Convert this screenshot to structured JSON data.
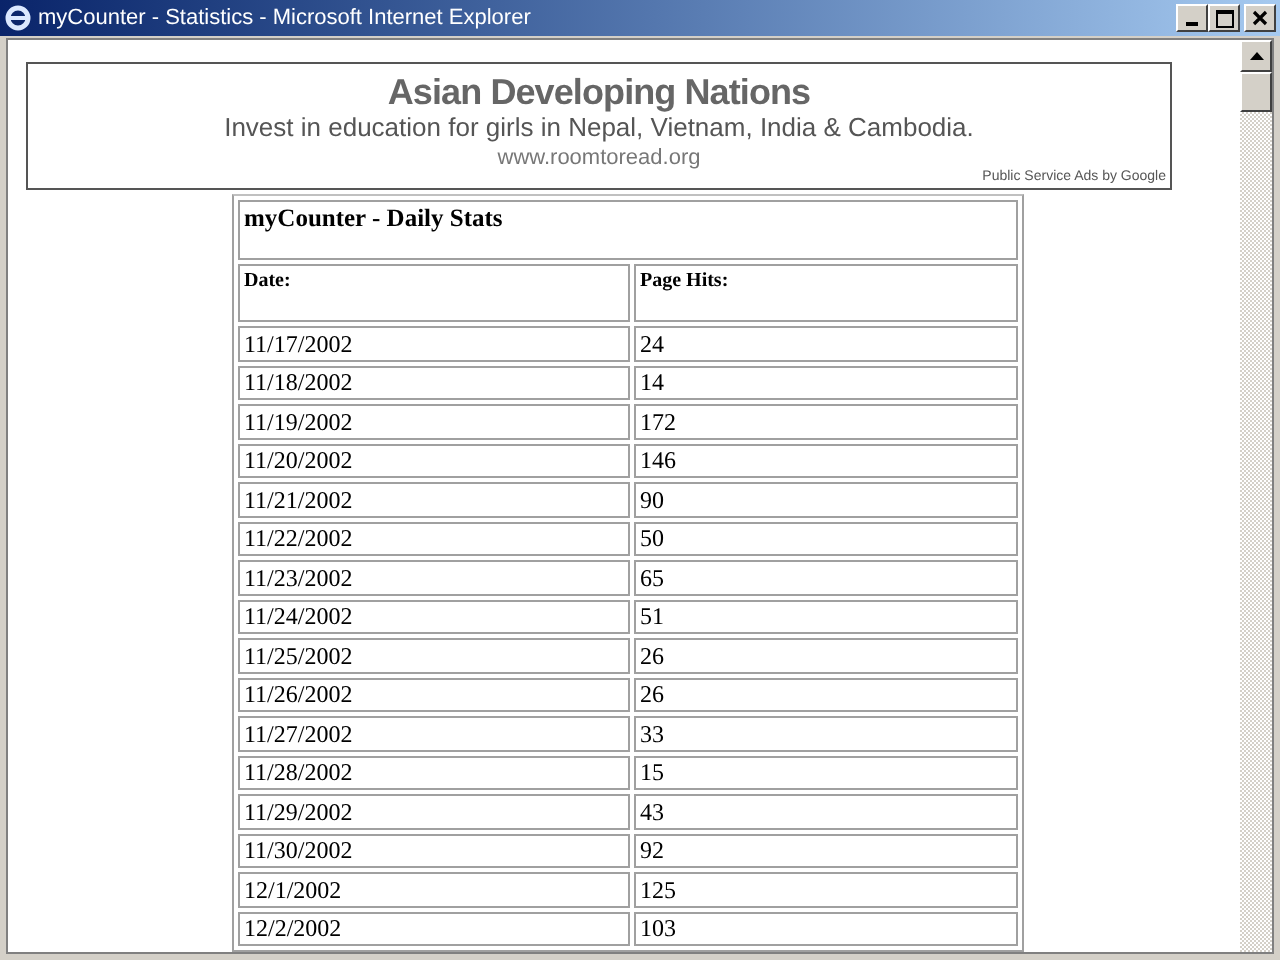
{
  "window": {
    "title": "myCounter - Statistics - Microsoft Internet Explorer"
  },
  "ad": {
    "headline": "Asian Developing Nations",
    "text": "Invest in education for girls in Nepal, Vietnam, India & Cambodia.",
    "url": "www.roomtoread.org",
    "footer": "Public Service Ads by Google"
  },
  "table": {
    "title": "myCounter - Daily Stats",
    "columns": [
      "Date:",
      "Page Hits:"
    ],
    "rows": [
      [
        "11/17/2002",
        "24"
      ],
      [
        "11/18/2002",
        "14"
      ],
      [
        "11/19/2002",
        "172"
      ],
      [
        "11/20/2002",
        "146"
      ],
      [
        "11/21/2002",
        "90"
      ],
      [
        "11/22/2002",
        "50"
      ],
      [
        "11/23/2002",
        "65"
      ],
      [
        "11/24/2002",
        "51"
      ],
      [
        "11/25/2002",
        "26"
      ],
      [
        "11/26/2002",
        "26"
      ],
      [
        "11/27/2002",
        "33"
      ],
      [
        "11/28/2002",
        "15"
      ],
      [
        "11/29/2002",
        "43"
      ],
      [
        "11/30/2002",
        "92"
      ],
      [
        "12/1/2002",
        "125"
      ],
      [
        "12/2/2002",
        "103"
      ]
    ]
  }
}
